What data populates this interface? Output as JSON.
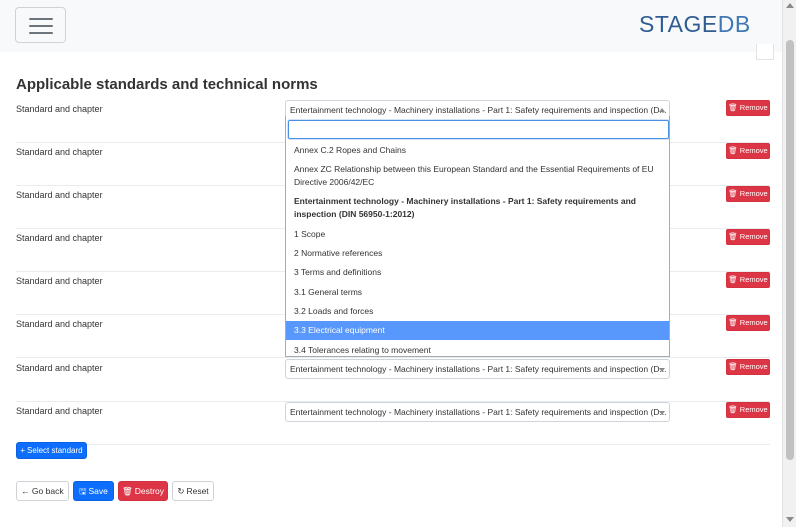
{
  "app": {
    "brand_part1": "STAGE",
    "brand_part2": "DB"
  },
  "page": {
    "title": "Applicable standards and technical norms"
  },
  "rows": [
    {
      "label": "Standard and chapter",
      "value": "Entertainment technology - Machinery installations - Part 1: Safety requirements and inspection (D...",
      "remove_label": "Remove"
    },
    {
      "label": "Standard and chapter",
      "value": "",
      "remove_label": "Remove"
    },
    {
      "label": "Standard and chapter",
      "value": "",
      "remove_label": "Remove"
    },
    {
      "label": "Standard and chapter",
      "value": "",
      "remove_label": "Remove"
    },
    {
      "label": "Standard and chapter",
      "value": "",
      "remove_label": "Remove"
    },
    {
      "label": "Standard and chapter",
      "value": "",
      "remove_label": "Remove"
    },
    {
      "label": "Standard and chapter",
      "value": "Entertainment technology - Machinery installations - Part 1: Safety requirements and inspection (D...",
      "remove_label": "Remove"
    },
    {
      "label": "Standard and chapter",
      "value": "Entertainment technology - Machinery installations - Part 1: Safety requirements and inspection (D...",
      "remove_label": "Remove"
    }
  ],
  "dropdown": {
    "search_value": "",
    "options": [
      {
        "label": "Annex C.2 Ropes and Chains",
        "type": "option"
      },
      {
        "label": "Annex ZC Relationship between this European Standard and the Essential Requirements of EU Directive 2006/42/EC",
        "type": "option"
      },
      {
        "label": "Entertainment technology - Machinery installations - Part 1: Safety requirements and inspection (DIN 56950-1:2012)",
        "type": "group"
      },
      {
        "label": "1 Scope",
        "type": "option"
      },
      {
        "label": "2 Normative references",
        "type": "option"
      },
      {
        "label": "3 Terms and definitions",
        "type": "option"
      },
      {
        "label": "3.1 General terms",
        "type": "option"
      },
      {
        "label": "3.2 Loads and forces",
        "type": "option"
      },
      {
        "label": "3.3 Electrical equipment",
        "type": "option",
        "highlighted": true
      },
      {
        "label": "3.4 Tolerances relating to movement",
        "type": "option"
      }
    ]
  },
  "actions": {
    "select_standard": "Select standard",
    "go_back": "Go back",
    "save": "Save",
    "destroy": "Destroy",
    "reset": "Reset"
  },
  "colors": {
    "primary": "#0d6efd",
    "danger": "#dc3545",
    "highlight": "#5897fb",
    "brand": "#2f5d92"
  }
}
